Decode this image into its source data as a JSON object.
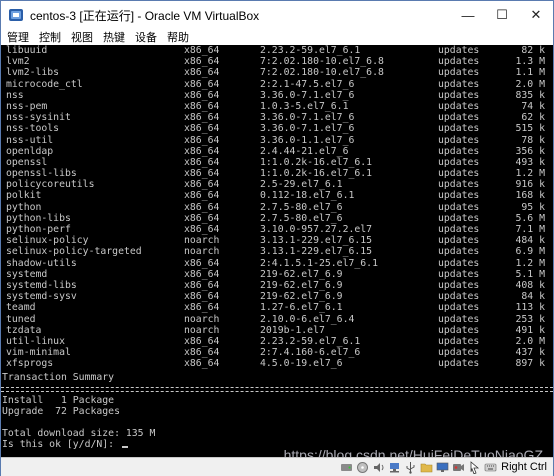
{
  "window": {
    "title": "centos-3 [正在运行] - Oracle VM VirtualBox",
    "controls": {
      "minimize": "—",
      "maximize": "☐",
      "close": "✕"
    }
  },
  "menu": [
    "管理",
    "控制",
    "视图",
    "热键",
    "设备",
    "帮助"
  ],
  "packages": [
    {
      "name": "libuuid",
      "arch": "x86_64",
      "version": "2.23.2-59.el7_6.1",
      "repo": "updates",
      "size": "82 k"
    },
    {
      "name": "lvm2",
      "arch": "x86_64",
      "version": "7:2.02.180-10.el7_6.8",
      "repo": "updates",
      "size": "1.3 M"
    },
    {
      "name": "lvm2-libs",
      "arch": "x86_64",
      "version": "7:2.02.180-10.el7_6.8",
      "repo": "updates",
      "size": "1.1 M"
    },
    {
      "name": "microcode_ctl",
      "arch": "x86_64",
      "version": "2:2.1-47.5.el7_6",
      "repo": "updates",
      "size": "2.0 M"
    },
    {
      "name": "nss",
      "arch": "x86_64",
      "version": "3.36.0-7.1.el7_6",
      "repo": "updates",
      "size": "835 k"
    },
    {
      "name": "nss-pem",
      "arch": "x86_64",
      "version": "1.0.3-5.el7_6.1",
      "repo": "updates",
      "size": "74 k"
    },
    {
      "name": "nss-sysinit",
      "arch": "x86_64",
      "version": "3.36.0-7.1.el7_6",
      "repo": "updates",
      "size": "62 k"
    },
    {
      "name": "nss-tools",
      "arch": "x86_64",
      "version": "3.36.0-7.1.el7_6",
      "repo": "updates",
      "size": "515 k"
    },
    {
      "name": "nss-util",
      "arch": "x86_64",
      "version": "3.36.0-1.1.el7_6",
      "repo": "updates",
      "size": "78 k"
    },
    {
      "name": "openldap",
      "arch": "x86_64",
      "version": "2.4.44-21.el7_6",
      "repo": "updates",
      "size": "356 k"
    },
    {
      "name": "openssl",
      "arch": "x86_64",
      "version": "1:1.0.2k-16.el7_6.1",
      "repo": "updates",
      "size": "493 k"
    },
    {
      "name": "openssl-libs",
      "arch": "x86_64",
      "version": "1:1.0.2k-16.el7_6.1",
      "repo": "updates",
      "size": "1.2 M"
    },
    {
      "name": "policycoreutils",
      "arch": "x86_64",
      "version": "2.5-29.el7_6.1",
      "repo": "updates",
      "size": "916 k"
    },
    {
      "name": "polkit",
      "arch": "x86_64",
      "version": "0.112-18.el7_6.1",
      "repo": "updates",
      "size": "168 k"
    },
    {
      "name": "python",
      "arch": "x86_64",
      "version": "2.7.5-80.el7_6",
      "repo": "updates",
      "size": "95 k"
    },
    {
      "name": "python-libs",
      "arch": "x86_64",
      "version": "2.7.5-80.el7_6",
      "repo": "updates",
      "size": "5.6 M"
    },
    {
      "name": "python-perf",
      "arch": "x86_64",
      "version": "3.10.0-957.27.2.el7",
      "repo": "updates",
      "size": "7.1 M"
    },
    {
      "name": "selinux-policy",
      "arch": "noarch",
      "version": "3.13.1-229.el7_6.15",
      "repo": "updates",
      "size": "484 k"
    },
    {
      "name": "selinux-policy-targeted",
      "arch": "noarch",
      "version": "3.13.1-229.el7_6.15",
      "repo": "updates",
      "size": "6.9 M"
    },
    {
      "name": "shadow-utils",
      "arch": "x86_64",
      "version": "2:4.1.5.1-25.el7_6.1",
      "repo": "updates",
      "size": "1.2 M"
    },
    {
      "name": "systemd",
      "arch": "x86_64",
      "version": "219-62.el7_6.9",
      "repo": "updates",
      "size": "5.1 M"
    },
    {
      "name": "systemd-libs",
      "arch": "x86_64",
      "version": "219-62.el7_6.9",
      "repo": "updates",
      "size": "408 k"
    },
    {
      "name": "systemd-sysv",
      "arch": "x86_64",
      "version": "219-62.el7_6.9",
      "repo": "updates",
      "size": "84 k"
    },
    {
      "name": "teamd",
      "arch": "x86_64",
      "version": "1.27-6.el7_6.1",
      "repo": "updates",
      "size": "113 k"
    },
    {
      "name": "tuned",
      "arch": "noarch",
      "version": "2.10.0-6.el7_6.4",
      "repo": "updates",
      "size": "253 k"
    },
    {
      "name": "tzdata",
      "arch": "noarch",
      "version": "2019b-1.el7",
      "repo": "updates",
      "size": "491 k"
    },
    {
      "name": "util-linux",
      "arch": "x86_64",
      "version": "2.23.2-59.el7_6.1",
      "repo": "updates",
      "size": "2.0 M"
    },
    {
      "name": "vim-minimal",
      "arch": "x86_64",
      "version": "2:7.4.160-6.el7_6",
      "repo": "updates",
      "size": "437 k"
    },
    {
      "name": "xfsprogs",
      "arch": "x86_64",
      "version": "4.5.0-19.el7_6",
      "repo": "updates",
      "size": "897 k"
    }
  ],
  "summary": {
    "heading": "Transaction Summary",
    "install": "Install   1 Package",
    "upgrade": "Upgrade  72 Packages",
    "total": "Total download size: 135 M",
    "prompt": "Is this ok [y/d/N]: "
  },
  "statusbar": {
    "watermark": "https://blog.csdn.net/HuiFeiDeTuoNiaoGZ",
    "host_key": "Right Ctrl",
    "icons": [
      "hard-disk-icon",
      "optical-drive-icon",
      "audio-icon",
      "network-icon",
      "usb-icon",
      "shared-folders-icon",
      "display-icon",
      "video-capture-icon",
      "mouse-integration-icon",
      "keyboard-icon"
    ]
  }
}
